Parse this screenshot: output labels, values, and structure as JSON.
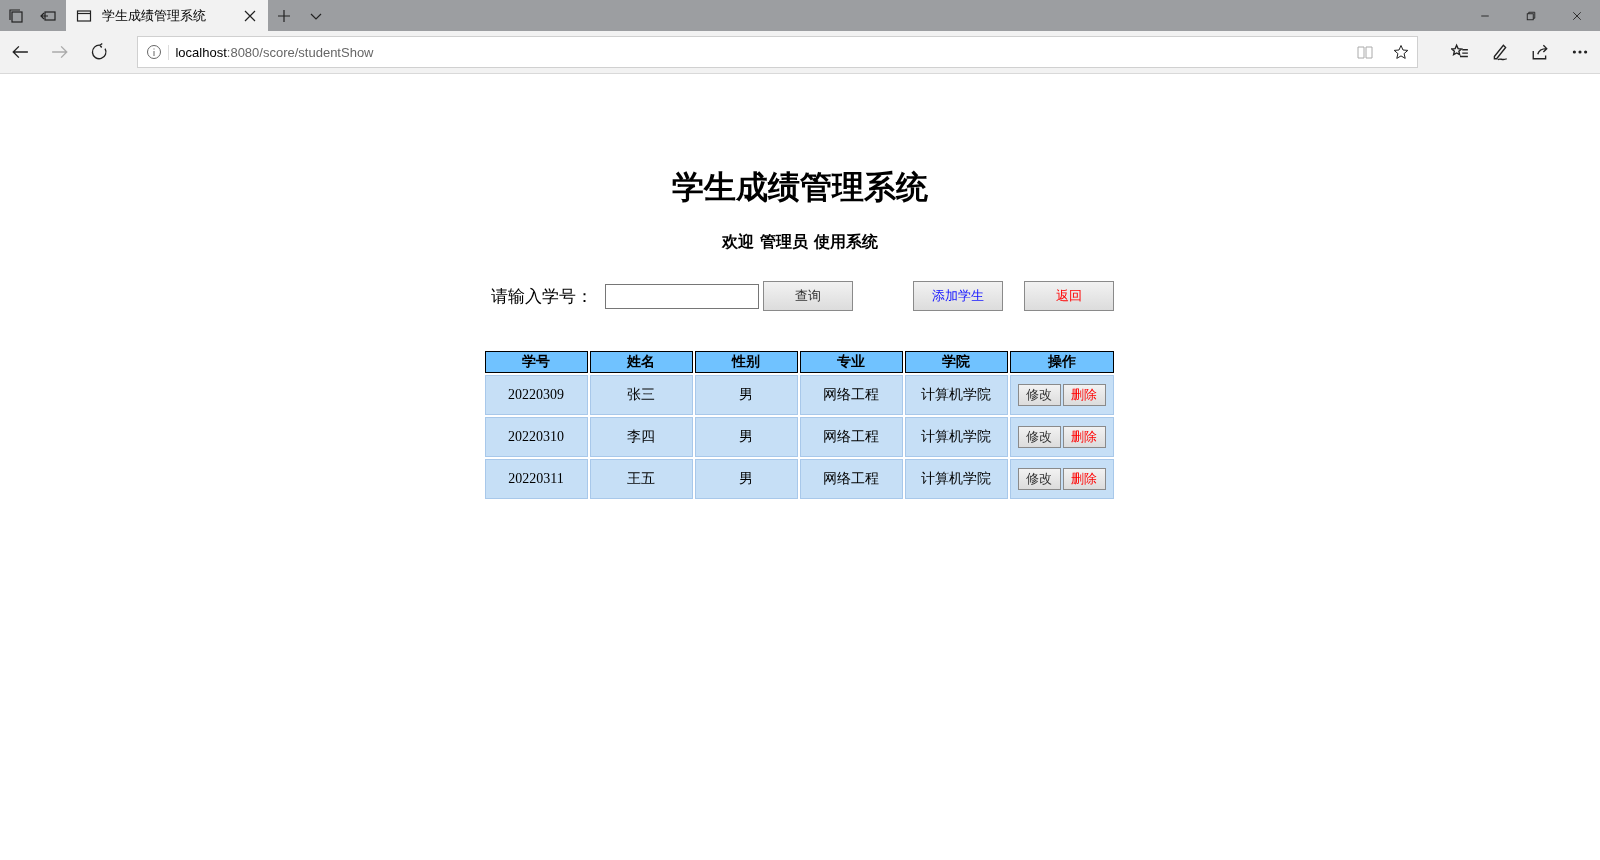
{
  "browser": {
    "tab_title": "学生成绩管理系统",
    "url_host": "localhost",
    "url_path": ":8080/score/studentShow"
  },
  "page": {
    "title": "学生成绩管理系统",
    "welcome": "欢迎 管理员 使用系统"
  },
  "search": {
    "label": "请输入学号："
  },
  "toolbar_buttons": [
    {
      "label": "查询",
      "kind": "plain"
    },
    {
      "label": "添加学生",
      "kind": "link"
    },
    {
      "label": "返回",
      "kind": "danger"
    }
  ],
  "table": {
    "columns": [
      "学号",
      "姓名",
      "性别",
      "专业",
      "学院",
      "操作"
    ],
    "rows": [
      {
        "cells": [
          "20220309",
          "张三",
          "男",
          "网络工程",
          "计算机学院"
        ],
        "actions": [
          {
            "label": "修改",
            "kind": "plain"
          },
          {
            "label": "删除",
            "kind": "danger"
          }
        ]
      },
      {
        "cells": [
          "20220310",
          "李四",
          "男",
          "网络工程",
          "计算机学院"
        ],
        "actions": [
          {
            "label": "修改",
            "kind": "plain"
          },
          {
            "label": "删除",
            "kind": "danger"
          }
        ]
      },
      {
        "cells": [
          "20220311",
          "王五",
          "男",
          "网络工程",
          "计算机学院"
        ],
        "actions": [
          {
            "label": "修改",
            "kind": "plain"
          },
          {
            "label": "删除",
            "kind": "danger"
          }
        ]
      }
    ]
  }
}
